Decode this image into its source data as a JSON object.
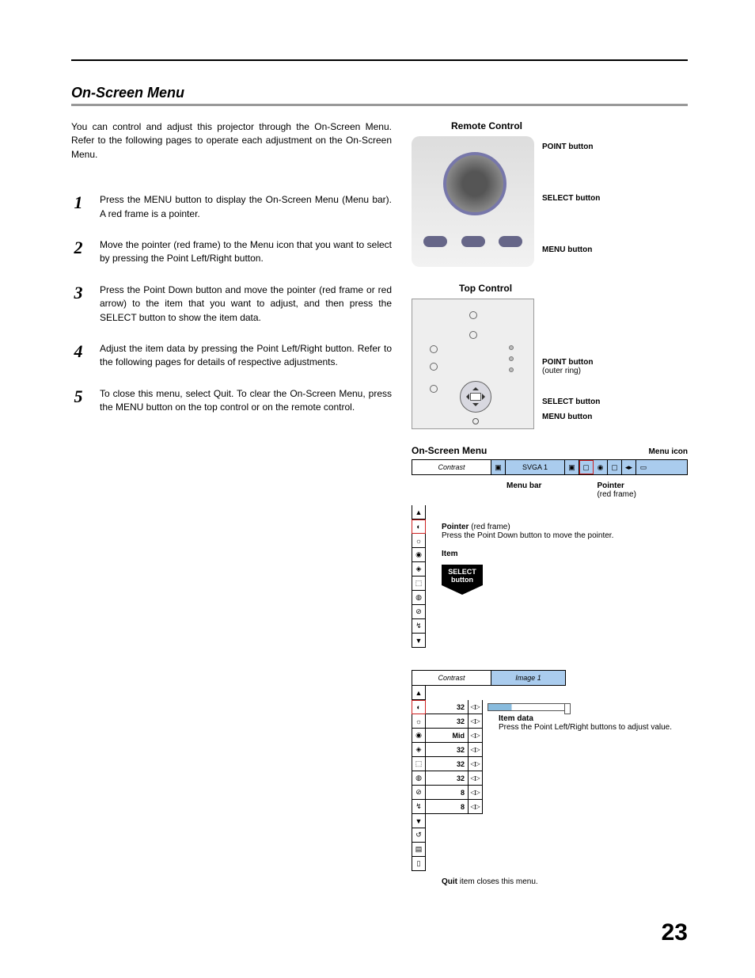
{
  "section_title": "On-Screen Menu",
  "intro": "You can control and adjust this projector through the On-Screen Menu.  Refer to the following pages to operate each adjustment on the On-Screen Menu.",
  "steps": [
    "Press the MENU button to display the On-Screen Menu (Menu bar).  A red frame is a pointer.",
    "Move the pointer (red frame) to the Menu icon that you want to select by pressing the Point Left/Right button.",
    "Press the Point Down button and move the pointer (red frame or red arrow) to the item that you want to adjust, and then press the SELECT button to show the item data.",
    "Adjust the item data by pressing the Point Left/Right button.  Refer to the following pages for details of respective adjustments.",
    "To close this menu, select Quit.  To clear the On-Screen Menu, press the MENU button on the top control or on the remote control."
  ],
  "remote": {
    "title": "Remote Control",
    "callouts": [
      "POINT button",
      "SELECT button",
      "MENU button"
    ]
  },
  "top": {
    "title": "Top Control",
    "callouts": [
      {
        "label": "POINT button",
        "sub": "(outer ring)"
      },
      {
        "label": "SELECT button",
        "sub": ""
      },
      {
        "label": "MENU button",
        "sub": ""
      }
    ]
  },
  "osd": {
    "title": "On-Screen Menu",
    "menu_icon_label": "Menu icon",
    "bar_title": "Contrast",
    "bar_mode": "SVGA 1",
    "menu_bar_label": "Menu bar",
    "pointer_label": "Pointer",
    "pointer_sub": "(red frame)",
    "side_pointer": "Pointer",
    "side_pointer_sub": "(red frame)",
    "side_pointer_text": "Press the Point Down button to move the pointer.",
    "item_label": "Item",
    "select_label": "SELECT button",
    "icons": [
      "▲",
      "◐",
      "☼",
      "◉",
      "◈",
      "⬚",
      "◍",
      "⊘",
      "↯",
      "▼"
    ]
  },
  "osd2": {
    "bar_title": "Contrast",
    "bar_mode": "Image 1",
    "rows": [
      {
        "icon": "▲",
        "val": "",
        "arr": "",
        "slider": false
      },
      {
        "icon": "◐",
        "val": "32",
        "arr": "◁▷",
        "slider": true
      },
      {
        "icon": "☼",
        "val": "32",
        "arr": "◁▷",
        "slider": false
      },
      {
        "icon": "◉",
        "val": "Mid",
        "arr": "◁▷",
        "slider": false
      },
      {
        "icon": "◈",
        "val": "32",
        "arr": "◁▷",
        "slider": false
      },
      {
        "icon": "⬚",
        "val": "32",
        "arr": "◁▷",
        "slider": false
      },
      {
        "icon": "◍",
        "val": "32",
        "arr": "◁▷",
        "slider": false
      },
      {
        "icon": "⊘",
        "val": "8",
        "arr": "◁▷",
        "slider": false
      },
      {
        "icon": "↯",
        "val": "8",
        "arr": "◁▷",
        "slider": false
      },
      {
        "icon": "▼",
        "val": "",
        "arr": "",
        "slider": false
      }
    ],
    "tail_icons": [
      "↺",
      "▤",
      "▯"
    ],
    "item_data_label": "Item data",
    "item_data_text": "Press the Point Left/Right buttons to adjust value.",
    "quit_label": "Quit",
    "quit_text": " item closes this menu."
  },
  "page_number": "23"
}
